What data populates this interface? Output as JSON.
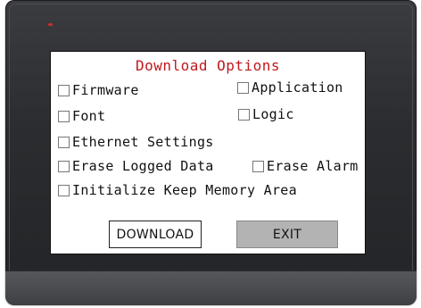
{
  "dialog": {
    "title": "Download Options",
    "title_color": "#c0181c",
    "options": {
      "firmware": {
        "label": "Firmware",
        "checked": false
      },
      "application": {
        "label": "Application",
        "checked": false
      },
      "font": {
        "label": "Font",
        "checked": false
      },
      "logic": {
        "label": "Logic",
        "checked": false
      },
      "ethernet_settings": {
        "label": "Ethernet Settings",
        "checked": false
      },
      "erase_logged_data": {
        "label": "Erase Logged Data",
        "checked": false
      },
      "erase_alarm": {
        "label": "Erase Alarm",
        "checked": false
      },
      "initialize_keep_memory": {
        "label": "Initialize Keep Memory Area",
        "checked": false
      }
    },
    "buttons": {
      "download_label": "DOWNLOAD",
      "exit_label": "EXIT"
    }
  },
  "colors": {
    "bezel": "#2b2d30",
    "screen_bg": "#ffffff",
    "exit_button_bg": "#b3b3b3",
    "status_led": "#c0302a"
  }
}
